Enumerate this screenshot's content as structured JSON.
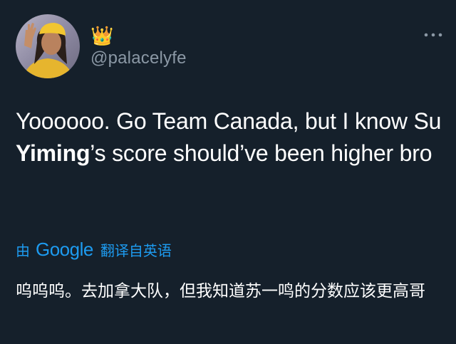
{
  "tweet": {
    "display_name": "👑",
    "handle": "@palacelyfe",
    "text_part1": "Yoooooo. Go Team Canada, but I know Su ",
    "text_bold": "Yiming",
    "text_part2": "’s score should’ve been higher bro"
  },
  "translation": {
    "by_label": "由",
    "provider": "Google",
    "link_label": "翻译自英语",
    "text": "呜呜呜。去加拿大队，但我知道苏一鸣的分数应该更高哥"
  },
  "icons": {
    "more": "more-horizontal-icon",
    "avatar": "profile-photo"
  },
  "colors": {
    "background": "#15202b",
    "text": "#ffffff",
    "secondary": "#8b98a5",
    "accent": "#1d9bf0"
  }
}
